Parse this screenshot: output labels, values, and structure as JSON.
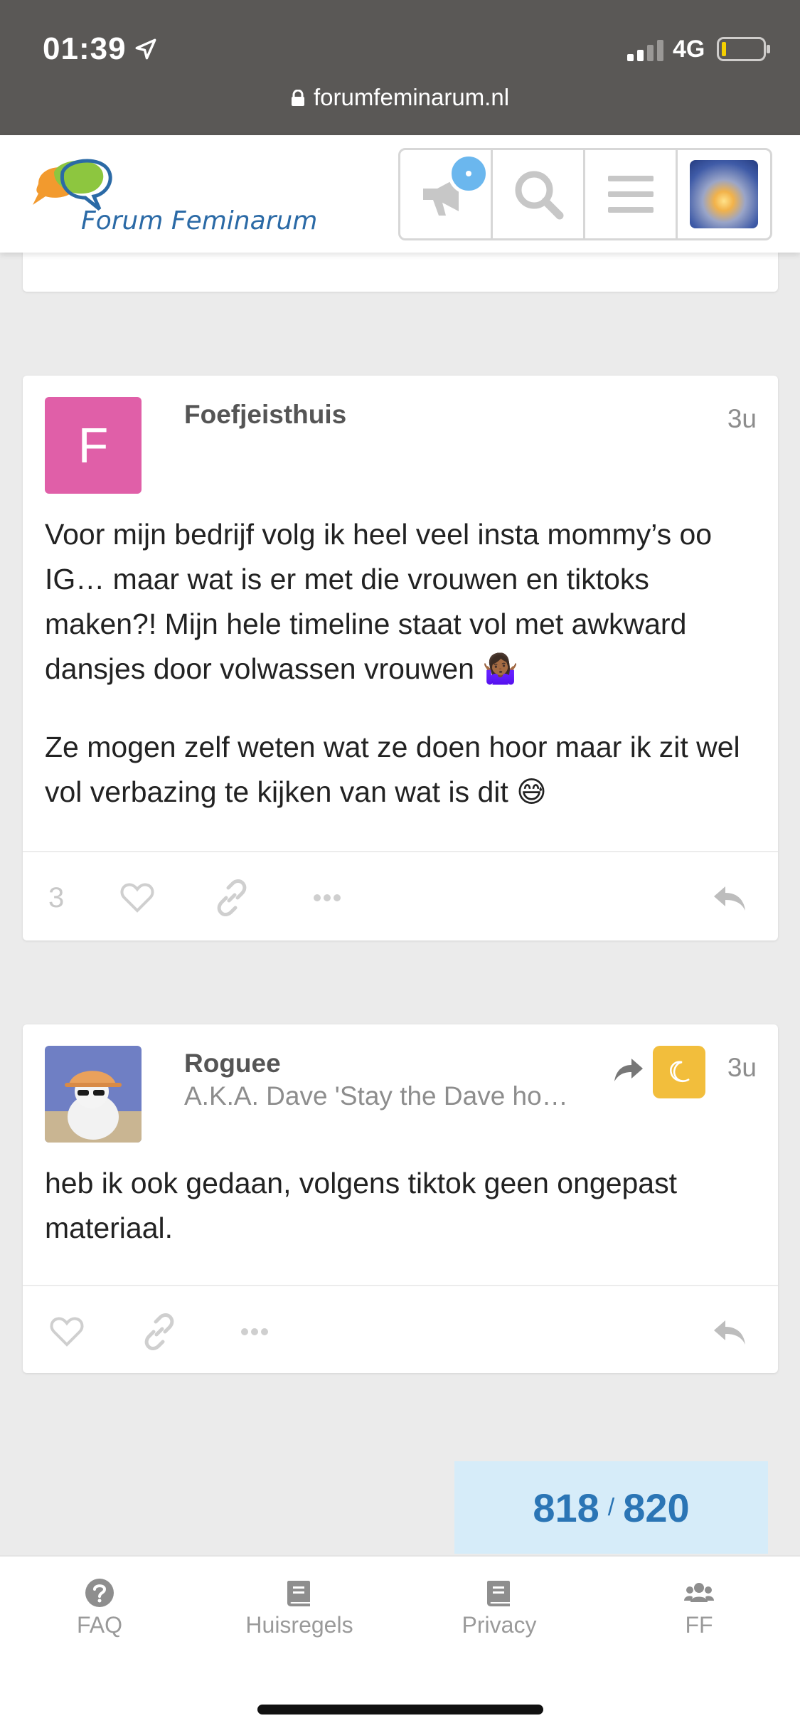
{
  "status_bar": {
    "time": "01:39",
    "network": "4G",
    "url": "forumfeminarum.nl"
  },
  "header": {
    "logo_text": "Forum Feminarum"
  },
  "posts": [
    {
      "avatar_letter": "F",
      "username": "Foefjeisthuis",
      "age": "3u",
      "paragraphs": [
        "Voor mijn bedrijf volg ik heel veel insta mommy’s oo IG… maar wat is er met die vrouwen en tiktoks maken?! Mijn hele timeline staat vol met awkward dansjes door volwassen vrouwen 🤷🏾‍♀️",
        "Ze mogen zelf weten wat ze doen hoor maar ik zit wel vol verbazing te kijken van wat is dit 😅"
      ],
      "like_count": "3"
    },
    {
      "username": "Roguee",
      "user_title": "A.K.A. Dave 'Stay the Dave ho…",
      "age": "3u",
      "paragraphs": [
        "heb ik ook gedaan, volgens tiktok geen ongepast materiaal."
      ]
    }
  ],
  "progress": {
    "current": "818",
    "separator": "/",
    "total": "820"
  },
  "bottom_nav": [
    {
      "label": "FAQ",
      "icon": "question-circle-icon"
    },
    {
      "label": "Huisregels",
      "icon": "book-icon"
    },
    {
      "label": "Privacy",
      "icon": "book-icon"
    },
    {
      "label": "FF",
      "icon": "users-icon"
    }
  ],
  "colors": {
    "avatar_f": "#e05fa8",
    "accent_blue": "#2b75b5",
    "progress_bg": "#d6ecf9",
    "notification": "#6bb7ee",
    "flair_yellow": "#f2be3c"
  }
}
